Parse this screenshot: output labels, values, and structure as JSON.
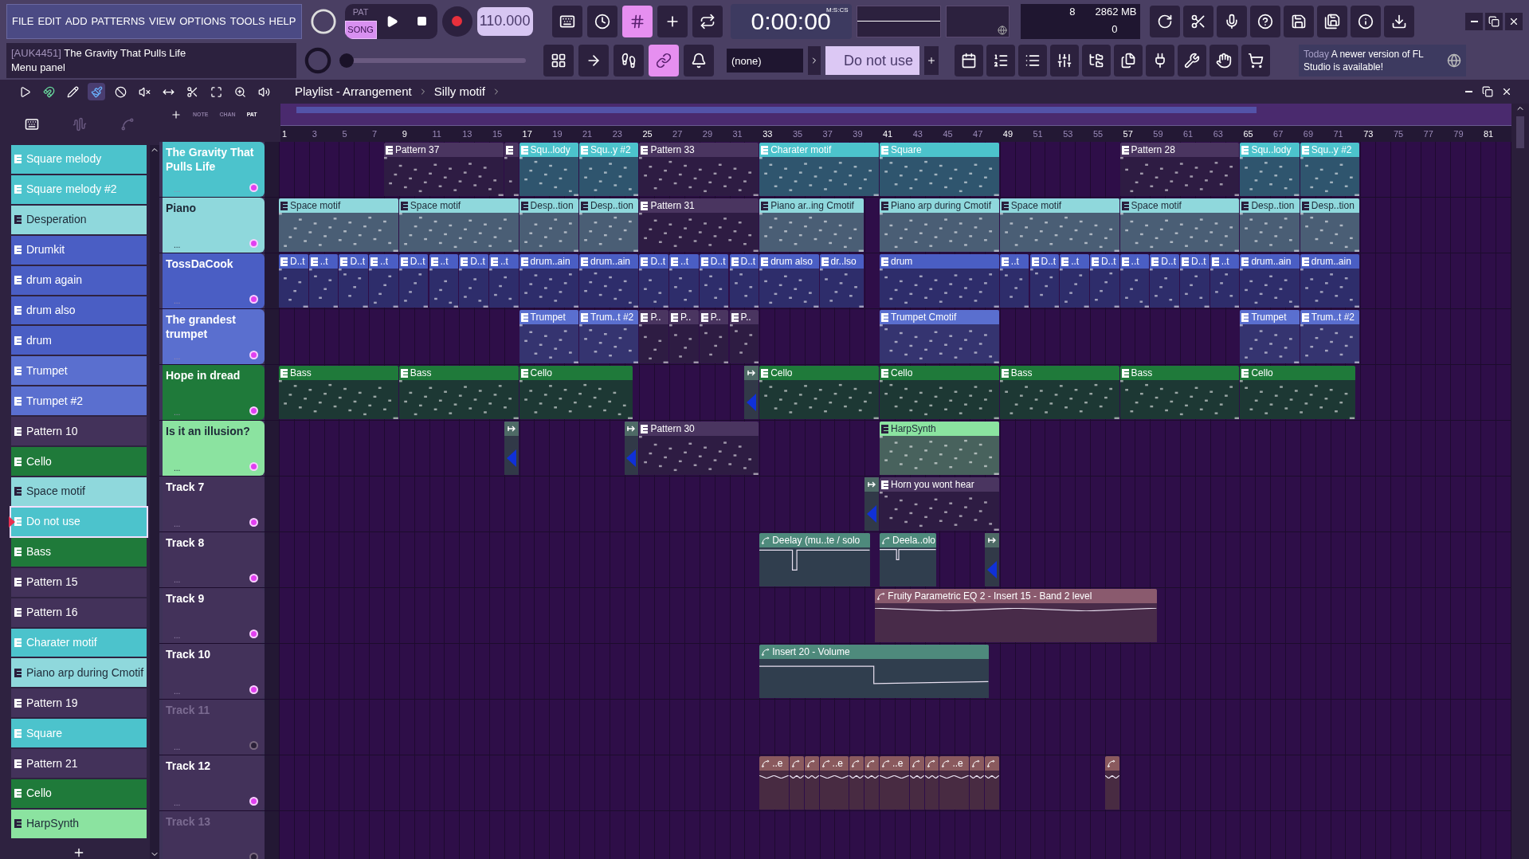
{
  "menu": [
    "FILE",
    "EDIT",
    "ADD",
    "PATTERNS",
    "VIEW",
    "OPTIONS",
    "TOOLS",
    "HELP"
  ],
  "hint": {
    "project": "[AUK4451]",
    "title": "The Gravity That Pulls Life",
    "text": "Menu panel"
  },
  "transport": {
    "modes": [
      {
        "label": "PAT",
        "selected": false
      },
      {
        "label": "SONG",
        "selected": true
      }
    ],
    "tempo": "110.000",
    "time": "0:00:00",
    "time_unit": "M:S:CS"
  },
  "toolbar_1": [
    {
      "on": false
    },
    {
      "on": false
    },
    {
      "on": true
    },
    {
      "on": false
    },
    {
      "on": false
    }
  ],
  "toolbar_2": [
    {
      "on": false
    },
    {
      "on": false
    },
    {
      "on": false
    },
    {
      "on": true
    },
    {
      "on": false
    }
  ],
  "cpu": {
    "value": "8",
    "memory": "2862 MB",
    "polyphony": "0"
  },
  "dropdown_1": {
    "value": "(none)"
  },
  "master_slider": {
    "level": 0.0
  },
  "pattern_field": {
    "value": "Do not use"
  },
  "news": {
    "date": "Today",
    "text": "A newer version of FL Studio is available!"
  },
  "playlist": {
    "title": "Playlist - Arrangement",
    "breadcrumb": "Silly motif",
    "tools": [
      {
        "selected": false
      },
      {
        "selected": false
      },
      {
        "selected": false
      },
      {
        "selected": true
      },
      {
        "selected": false
      },
      {
        "selected": false
      },
      {
        "selected": false
      },
      {
        "selected": false
      },
      {
        "selected": false
      },
      {
        "selected": false
      },
      {
        "selected": false
      }
    ],
    "picker_views": [
      {
        "selected": true
      },
      {
        "selected": false
      },
      {
        "selected": false
      }
    ],
    "picker_tabs": [
      {
        "label": "NOTE",
        "selected": false
      },
      {
        "label": "CHAN",
        "selected": false
      },
      {
        "label": "PAT",
        "selected": true
      }
    ],
    "ruler": [
      "1",
      "3",
      "5",
      "7",
      "9",
      "11",
      "13",
      "15",
      "17",
      "19",
      "21",
      "23",
      "25",
      "27",
      "29",
      "31",
      "33",
      "35",
      "37",
      "39",
      "41",
      "43",
      "45",
      "47",
      "49",
      "51",
      "53",
      "55",
      "57",
      "59",
      "61",
      "63",
      "65",
      "67",
      "69",
      "71",
      "73",
      "75",
      "77",
      "79",
      "81"
    ]
  },
  "patterns": [
    {
      "name": "Square melody",
      "color": "#4cc3cc",
      "selected": false
    },
    {
      "name": "Square melody #2",
      "color": "#4cc3cc",
      "selected": false
    },
    {
      "name": "Desperation",
      "color": "#8fd8dc",
      "selected": false
    },
    {
      "name": "Drumkit",
      "color": "#4a5ec4",
      "selected": false
    },
    {
      "name": "drum again",
      "color": "#4a5ec4",
      "selected": false
    },
    {
      "name": "drum also",
      "color": "#4a5ec4",
      "selected": false
    },
    {
      "name": "drum",
      "color": "#4a5ec4",
      "selected": false
    },
    {
      "name": "Trumpet",
      "color": "#5a6fcf",
      "selected": false
    },
    {
      "name": "Trumpet #2",
      "color": "#5a6fcf",
      "selected": false
    },
    {
      "name": "Pattern 10",
      "color": "#43325a",
      "selected": false
    },
    {
      "name": "Cello",
      "color": "#1f7a3a",
      "selected": false
    },
    {
      "name": "Space motif",
      "color": "#8fd8dc",
      "selected": false
    },
    {
      "name": "Do not use",
      "color": "#4cc3cc",
      "selected": true
    },
    {
      "name": "Bass",
      "color": "#1f7a3a",
      "selected": false
    },
    {
      "name": "Pattern 15",
      "color": "#43325a",
      "selected": false
    },
    {
      "name": "Pattern 16",
      "color": "#43325a",
      "selected": false
    },
    {
      "name": "Charater motif",
      "color": "#4cc3cc",
      "selected": false
    },
    {
      "name": "Piano arp during Cmotif",
      "color": "#8fd8dc",
      "selected": false
    },
    {
      "name": "Pattern 19",
      "color": "#43325a",
      "selected": false
    },
    {
      "name": "Square",
      "color": "#4cc3cc",
      "selected": false
    },
    {
      "name": "Pattern 21",
      "color": "#43325a",
      "selected": false
    },
    {
      "name": "Cello",
      "color": "#1f7a3a",
      "selected": false
    },
    {
      "name": "HarpSynth",
      "color": "#8be3a0",
      "selected": false
    }
  ],
  "tracks": [
    {
      "name": "The Gravity That Pulls Life",
      "color": "#4cc3cc",
      "enabled": true,
      "more": "...",
      "clips": [
        {
          "kind": "pattern",
          "label": "Pattern 37",
          "color": "#4a3560"
        },
        {
          "kind": "pattern",
          "color": "#4a3560"
        },
        {
          "kind": "pattern",
          "label": "Squ..lody",
          "color": "#4cc3cc"
        },
        {
          "kind": "pattern",
          "label": "Squ..y #2",
          "color": "#4cc3cc"
        },
        {
          "kind": "pattern",
          "label": "Pattern 33",
          "color": "#4a3560"
        },
        {
          "kind": "pattern",
          "label": "Charater motif",
          "color": "#4cc3cc"
        },
        {
          "kind": "pattern",
          "label": "Square",
          "color": "#4cc3cc"
        },
        {
          "kind": "pattern",
          "label": "Pattern 28",
          "color": "#4a3560"
        },
        {
          "kind": "pattern",
          "label": "Squ..lody",
          "color": "#4cc3cc"
        },
        {
          "kind": "pattern",
          "label": "Squ..y #2",
          "color": "#4cc3cc"
        }
      ]
    },
    {
      "name": "Piano",
      "color": "#8fd8dc",
      "enabled": true,
      "more": "...",
      "clips": [
        {
          "kind": "pattern",
          "label": "Space motif",
          "color": "#8fd8dc"
        },
        {
          "kind": "pattern",
          "label": "Space motif",
          "color": "#8fd8dc"
        },
        {
          "kind": "pattern",
          "label": "Desp..tion",
          "color": "#8fd8dc"
        },
        {
          "kind": "pattern",
          "label": "Desp..tion",
          "color": "#8fd8dc"
        },
        {
          "kind": "pattern",
          "label": "Pattern 31",
          "color": "#4a3560"
        },
        {
          "kind": "pattern",
          "label": "Piano ar..ing Cmotif",
          "color": "#8fd8dc"
        },
        {
          "kind": "pattern",
          "label": "Piano arp during Cmotif",
          "color": "#8fd8dc"
        },
        {
          "kind": "pattern",
          "label": "Space motif",
          "color": "#8fd8dc"
        },
        {
          "kind": "pattern",
          "label": "Space motif",
          "color": "#8fd8dc"
        },
        {
          "kind": "pattern",
          "label": "Desp..tion",
          "color": "#8fd8dc"
        },
        {
          "kind": "pattern",
          "label": "Desp..tion",
          "color": "#8fd8dc"
        }
      ]
    },
    {
      "name": "TossDaCook",
      "color": "#4a5ec4",
      "enabled": true,
      "more": "...",
      "clips": [
        {
          "kind": "pattern",
          "label": "D..t",
          "color": "#4a5ec4"
        },
        {
          "kind": "pattern",
          "label": "..t",
          "color": "#4a5ec4"
        },
        {
          "kind": "pattern",
          "label": "D..t",
          "color": "#4a5ec4"
        },
        {
          "kind": "pattern",
          "label": "..t",
          "color": "#4a5ec4"
        },
        {
          "kind": "pattern",
          "label": "D..t",
          "color": "#4a5ec4"
        },
        {
          "kind": "pattern",
          "label": "..t",
          "color": "#4a5ec4"
        },
        {
          "kind": "pattern",
          "label": "D..t",
          "color": "#4a5ec4"
        },
        {
          "kind": "pattern",
          "label": "..t",
          "color": "#4a5ec4"
        },
        {
          "kind": "pattern",
          "label": "drum..ain",
          "color": "#4a5ec4"
        },
        {
          "kind": "pattern",
          "label": "drum..ain",
          "color": "#4a5ec4"
        },
        {
          "kind": "pattern",
          "label": "D..t",
          "color": "#4a5ec4"
        },
        {
          "kind": "pattern",
          "label": "..t",
          "color": "#4a5ec4"
        },
        {
          "kind": "pattern",
          "label": "D..t",
          "color": "#4a5ec4"
        },
        {
          "kind": "pattern",
          "label": "D..t",
          "color": "#4a5ec4"
        },
        {
          "kind": "pattern",
          "label": "drum also",
          "color": "#4a5ec4"
        },
        {
          "kind": "pattern",
          "label": "dr..lso",
          "color": "#4a5ec4"
        },
        {
          "kind": "pattern",
          "label": "drum",
          "color": "#4a5ec4"
        },
        {
          "kind": "pattern",
          "label": "..t",
          "color": "#4a5ec4"
        },
        {
          "kind": "pattern",
          "label": "D..t",
          "color": "#4a5ec4"
        },
        {
          "kind": "pattern",
          "label": "..t",
          "color": "#4a5ec4"
        },
        {
          "kind": "pattern",
          "label": "D..t",
          "color": "#4a5ec4"
        },
        {
          "kind": "pattern",
          "label": "..t",
          "color": "#4a5ec4"
        },
        {
          "kind": "pattern",
          "label": "D..t",
          "color": "#4a5ec4"
        },
        {
          "kind": "pattern",
          "label": "D..t",
          "color": "#4a5ec4"
        },
        {
          "kind": "pattern",
          "label": "..t",
          "color": "#4a5ec4"
        },
        {
          "kind": "pattern",
          "label": "drum..ain",
          "color": "#4a5ec4"
        },
        {
          "kind": "pattern",
          "label": "drum..ain",
          "color": "#4a5ec4"
        }
      ]
    },
    {
      "name": "The grandest trumpet",
      "color": "#5a6fcf",
      "enabled": true,
      "more": "...",
      "clips": [
        {
          "kind": "pattern",
          "label": "Trumpet",
          "color": "#5a6fcf"
        },
        {
          "kind": "pattern",
          "label": "Trum..t #2",
          "color": "#5a6fcf"
        },
        {
          "kind": "pattern",
          "label": "P..",
          "color": "#4a3560"
        },
        {
          "kind": "pattern",
          "label": "P..",
          "color": "#4a3560"
        },
        {
          "kind": "pattern",
          "label": "P..",
          "color": "#4a3560"
        },
        {
          "kind": "pattern",
          "label": "P..",
          "color": "#4a3560"
        },
        {
          "kind": "pattern",
          "label": "Trumpet Cmotif",
          "color": "#5a6fcf"
        },
        {
          "kind": "pattern",
          "label": "Trumpet",
          "color": "#5a6fcf"
        },
        {
          "kind": "pattern",
          "label": "Trum..t #2",
          "color": "#5a6fcf"
        }
      ]
    },
    {
      "name": "Hope in dread",
      "color": "#1f7a3a",
      "enabled": true,
      "more": "...",
      "clips": [
        {
          "kind": "pattern",
          "label": "Bass",
          "color": "#1f7a3a"
        },
        {
          "kind": "pattern",
          "label": "Bass",
          "color": "#1f7a3a"
        },
        {
          "kind": "pattern",
          "label": "Cello",
          "color": "#1f7a3a"
        },
        {
          "kind": "marker",
          "color": "#4e6a66"
        },
        {
          "kind": "pattern",
          "label": "Cello",
          "color": "#1f7a3a"
        },
        {
          "kind": "pattern",
          "label": "Cello",
          "color": "#1f7a3a"
        },
        {
          "kind": "pattern",
          "label": "Bass",
          "color": "#1f7a3a"
        },
        {
          "kind": "pattern",
          "label": "Bass",
          "color": "#1f7a3a"
        },
        {
          "kind": "pattern",
          "label": "Cello",
          "color": "#1f7a3a"
        }
      ]
    },
    {
      "name": "Is it an illusion?",
      "color": "#8be3a0",
      "enabled": true,
      "more": "...",
      "clips": [
        {
          "kind": "marker",
          "color": "#4e6a66"
        },
        {
          "kind": "marker",
          "color": "#4e6a66"
        },
        {
          "kind": "pattern",
          "label": "Pattern 30",
          "color": "#4a3560"
        },
        {
          "kind": "pattern",
          "label": "HarpSynth",
          "color": "#8be3a0"
        }
      ]
    },
    {
      "name": "Track 7",
      "color": "#43325a",
      "enabled": true,
      "more": "...",
      "clips": [
        {
          "kind": "marker",
          "color": "#4e6a66"
        },
        {
          "kind": "pattern",
          "label": "Horn you wont hear",
          "color": "#4a3560"
        }
      ]
    },
    {
      "name": "Track 8",
      "color": "#43325a",
      "enabled": true,
      "more": "...",
      "clips": [
        {
          "kind": "automation",
          "label": "Deelay (mu..te / solo",
          "color": "#4e8a7c"
        },
        {
          "kind": "automation",
          "label": "Deela..olo",
          "color": "#4e8a7c"
        },
        {
          "kind": "marker",
          "color": "#4e6a66"
        }
      ]
    },
    {
      "name": "Track 9",
      "color": "#43325a",
      "enabled": true,
      "more": "...",
      "clips": [
        {
          "kind": "automation",
          "label": "Fruity Parametric EQ 2 - Insert 15 - Band 2 level",
          "color": "#8a5a6e"
        }
      ]
    },
    {
      "name": "Track 10",
      "color": "#43325a",
      "enabled": true,
      "more": "...",
      "clips": [
        {
          "kind": "automation",
          "label": "Insert 20 - Volume",
          "color": "#4e8a7c"
        }
      ]
    },
    {
      "name": "Track 11",
      "color": "#43325a",
      "enabled": false,
      "more": "..."
    },
    {
      "name": "Track 12",
      "color": "#43325a",
      "enabled": true,
      "more": "...",
      "clips": [
        {
          "kind": "automation",
          "label": "..e",
          "color": "#8a5a5e"
        },
        {
          "kind": "automation",
          "color": "#8a5a5e"
        },
        {
          "kind": "automation",
          "color": "#8a5a5e"
        },
        {
          "kind": "automation",
          "label": "..e",
          "color": "#8a5a5e"
        },
        {
          "kind": "automation",
          "color": "#8a5a5e"
        },
        {
          "kind": "automation",
          "color": "#8a5a5e"
        },
        {
          "kind": "automation",
          "label": "..e",
          "color": "#8a5a5e"
        },
        {
          "kind": "automation",
          "color": "#8a5a5e"
        },
        {
          "kind": "automation",
          "color": "#8a5a5e"
        },
        {
          "kind": "automation",
          "label": "..e",
          "color": "#8a5a5e"
        },
        {
          "kind": "automation",
          "color": "#8a5a5e"
        },
        {
          "kind": "automation",
          "color": "#8a5a5e"
        },
        {
          "kind": "automation",
          "color": "#8a5a5e"
        }
      ]
    },
    {
      "name": "Track 13",
      "color": "#43325a",
      "enabled": false
    }
  ]
}
